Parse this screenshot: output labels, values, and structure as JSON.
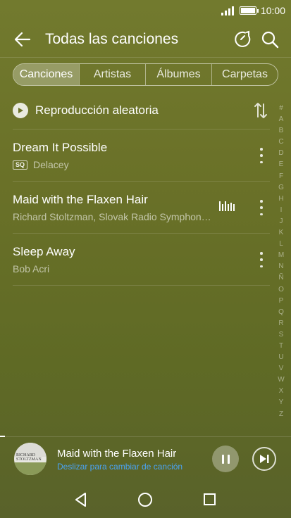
{
  "status_bar": {
    "time": "10:00"
  },
  "header": {
    "title": "Todas las canciones"
  },
  "tabs": [
    {
      "label": "Canciones",
      "active": true
    },
    {
      "label": "Artistas",
      "active": false
    },
    {
      "label": "Álbumes",
      "active": false
    },
    {
      "label": "Carpetas",
      "active": false
    }
  ],
  "shuffle": {
    "label": "Reproducción aleatoria"
  },
  "songs": [
    {
      "title": "Dream It Possible",
      "badge": "SQ",
      "artist": "Delacey",
      "playing": false
    },
    {
      "title": "Maid with the Flaxen Hair",
      "badge": "",
      "artist": "Richard Stoltzman, Slovak Radio Symphon…",
      "playing": true
    },
    {
      "title": "Sleep Away",
      "badge": "",
      "artist": "Bob Acri",
      "playing": false
    }
  ],
  "index_letters": [
    "#",
    "A",
    "B",
    "C",
    "D",
    "E",
    "F",
    "G",
    "H",
    "I",
    "J",
    "K",
    "L",
    "M",
    "N",
    "Ñ",
    "O",
    "P",
    "Q",
    "R",
    "S",
    "T",
    "U",
    "V",
    "W",
    "X",
    "Y",
    "Z"
  ],
  "mini_player": {
    "title": "Maid with the Flaxen Hair",
    "subtitle": "Deslizar para cambiar de canción",
    "cover_text": "RICHARD STOLTZMAN"
  },
  "colors": {
    "background": "#6a7128",
    "accent": "#4aa3f2"
  }
}
